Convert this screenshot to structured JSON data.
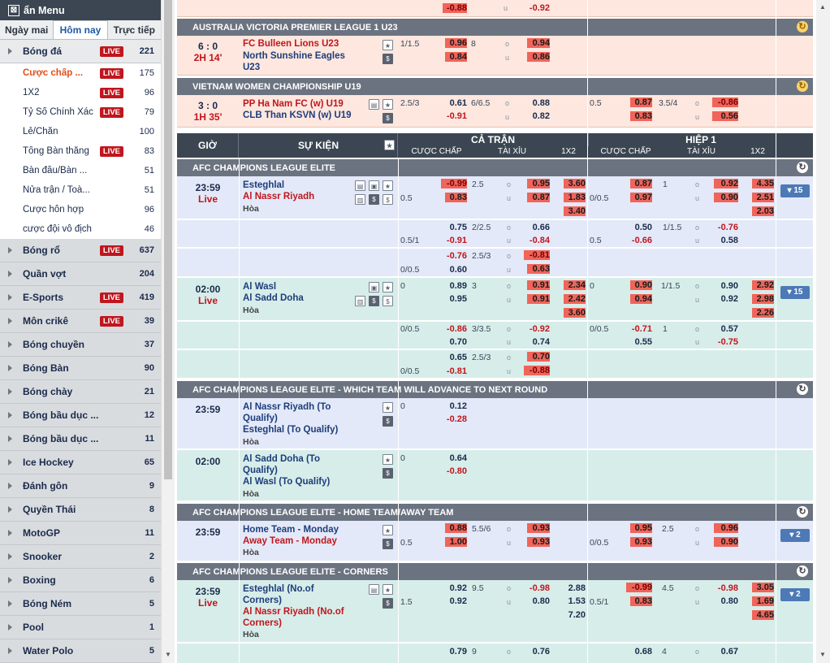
{
  "sidebar": {
    "menu_title": "ẩn Menu",
    "tabs": [
      "Ngày mai",
      "Hôm nay",
      "Trực tiếp"
    ],
    "active_tab": 1,
    "live_label": "LIVE",
    "first_sport": {
      "name": "Bóng đá",
      "count": "221",
      "live": true
    },
    "subs": [
      {
        "name": "Cược chấp ...",
        "count": "175",
        "live": true,
        "active": true
      },
      {
        "name": "1X2",
        "count": "96",
        "live": true
      },
      {
        "name": "Tỷ Số Chính Xác",
        "count": "79",
        "live": true
      },
      {
        "name": "Lẻ/Chẵn",
        "count": "100",
        "live": false
      },
      {
        "name": "Tổng Bàn thắng",
        "count": "83",
        "live": true
      },
      {
        "name": "Bàn đầu/Bàn ...",
        "count": "51",
        "live": false
      },
      {
        "name": "Nửa trận / Toà...",
        "count": "51",
        "live": false
      },
      {
        "name": "Cược hỗn hợp",
        "count": "96",
        "live": false
      },
      {
        "name": "cược đội vô địch",
        "count": "46",
        "live": false
      }
    ],
    "sports": [
      {
        "name": "Bóng rổ",
        "count": "637",
        "live": true
      },
      {
        "name": "Quần vợt",
        "count": "204",
        "live": false
      },
      {
        "name": "E-Sports",
        "count": "419",
        "live": true
      },
      {
        "name": "Môn crikê",
        "count": "39",
        "live": true
      },
      {
        "name": "Bóng chuyền",
        "count": "37",
        "live": false
      },
      {
        "name": "Bóng Bàn",
        "count": "90",
        "live": false
      },
      {
        "name": "Bóng chày",
        "count": "21",
        "live": false
      },
      {
        "name": "Bóng bầu dục ...",
        "count": "12",
        "live": false
      },
      {
        "name": "Bóng bầu dục ...",
        "count": "11",
        "live": false
      },
      {
        "name": "Ice Hockey",
        "count": "65",
        "live": false
      },
      {
        "name": "Đánh gôn",
        "count": "9",
        "live": false
      },
      {
        "name": "Quyền Thái",
        "count": "8",
        "live": false
      },
      {
        "name": "MotoGP",
        "count": "11",
        "live": false
      },
      {
        "name": "Snooker",
        "count": "2",
        "live": false
      },
      {
        "name": "Boxing",
        "count": "6",
        "live": false
      },
      {
        "name": "Bóng Ném",
        "count": "5",
        "live": false
      },
      {
        "name": "Pool",
        "count": "1",
        "live": false
      },
      {
        "name": "Water Polo",
        "count": "5",
        "live": false
      }
    ]
  },
  "top_partial": {
    "v1": "-0.88",
    "u": "u",
    "v2": "-0.92"
  },
  "live_leagues": [
    {
      "name": "AUSTRALIA VICTORIA PREMIER LEAGUE 1 U23",
      "score": "6 : 0",
      "status": "2H 14'",
      "home": "FC Bulleen Lions U23",
      "away": "North Sunshine Eagles U23",
      "hdp": "1/1.5",
      "hdp_home": "0.96",
      "hdp_away": "0.84",
      "ou_line": "8",
      "o": "o",
      "u": "u",
      "ou_over": "0.94",
      "ou_under": "0.86"
    },
    {
      "name": "VIETNAM WOMEN CHAMPIONSHIP U19",
      "score": "3 : 0",
      "status": "1H 35'",
      "home": "PP Ha Nam FC (w) U19",
      "away": "CLB Than KSVN (w) U19",
      "hdp": "2.5/3",
      "hdp_home": "0.61",
      "hdp_away": "-0.91",
      "ou_line": "6/6.5",
      "o": "o",
      "u": "u",
      "ou_over": "0.88",
      "ou_under": "0.82",
      "h1_hdp": "0.5",
      "h1_home": "0.87",
      "h1_away": "0.83",
      "h1_ou_line": "3.5/4",
      "h1_over": "-0.86",
      "h1_under": "0.56"
    }
  ],
  "table_header": {
    "time": "GIỜ",
    "event": "SỰ KIỆN",
    "full": "CẢ TRẬN",
    "half": "HIỆP 1",
    "hdp": "CƯỢC CHẤP",
    "ou": "TÀI XỈU",
    "x12": "1X2"
  },
  "sections": [
    {
      "title": "AFC CHAMPIONS LEAGUE ELITE"
    },
    {
      "title": "AFC CHAMPIONS LEAGUE ELITE - WHICH TEAM WILL ADVANCE TO NEXT ROUND"
    },
    {
      "title": "AFC CHAMPIONS LEAGUE ELITE - HOME TEAM/AWAY TEAM"
    },
    {
      "title": "AFC CHAMPIONS LEAGUE ELITE - CORNERS"
    }
  ],
  "draw_label": "Hòa",
  "m1": {
    "time": "23:59",
    "status": "Live",
    "home": "Esteghlal",
    "away": "Al Nassr Riyadh",
    "more": "▾ 15",
    "r1": [
      "-0.99",
      "2.5",
      "0.95",
      "3.60",
      "0.87",
      "1",
      "0.92",
      "4.35"
    ],
    "r2": [
      "0.5",
      "0.83",
      "0.87",
      "1.83",
      "0/0.5",
      "0.97",
      "0.90",
      "2.51"
    ],
    "r3": [
      "3.40",
      "2.03"
    ],
    "l2a": [
      "0.75",
      "2/2.5",
      "0.66",
      "0.50",
      "1/1.5",
      "-0.76"
    ],
    "l2b": [
      "0.5/1",
      "-0.91",
      "-0.84",
      "0.5",
      "-0.66",
      "0.58"
    ],
    "l3a": [
      "-0.76",
      "2.5/3",
      "-0.81"
    ],
    "l3b": [
      "0/0.5",
      "0.60",
      "0.63"
    ]
  },
  "m2": {
    "time": "02:00",
    "status": "Live",
    "home": "Al Wasl",
    "away": "Al Sadd Doha",
    "more": "▾ 15",
    "r1": [
      "0",
      "0.89",
      "3",
      "0.91",
      "2.34",
      "0",
      "0.90",
      "1/1.5",
      "0.90",
      "2.92"
    ],
    "r2": [
      "0.95",
      "0.91",
      "2.42",
      "0.94",
      "0.92",
      "2.98"
    ],
    "r3": [
      "3.60",
      "2.26"
    ],
    "l2a": [
      "0/0.5",
      "-0.86",
      "3/3.5",
      "-0.92",
      "0/0.5",
      "-0.71",
      "1",
      "0.57"
    ],
    "l2b": [
      "0.70",
      "0.74",
      "0.55",
      "-0.75"
    ],
    "l3a": [
      "0.65",
      "2.5/3",
      "0.70"
    ],
    "l3b": [
      "0/0.5",
      "-0.81",
      "-0.88"
    ]
  },
  "adv1": {
    "time": "23:59",
    "home": "Al Nassr Riyadh (To Qualify)",
    "away": "Esteghlal (To Qualify)",
    "hdp": "0",
    "v1": "0.12",
    "v2": "-0.28"
  },
  "adv2": {
    "time": "02:00",
    "home": "Al Sadd Doha (To Qualify)",
    "away": "Al Wasl (To Qualify)",
    "hdp": "0",
    "v1": "0.64",
    "v2": "-0.80"
  },
  "ha": {
    "time": "23:59",
    "home": "Home Team - Monday",
    "away": "Away Team - Monday",
    "more": "▾ 2",
    "r1": [
      "0.88",
      "5.5/6",
      "0.93",
      "0.95",
      "2.5",
      "0.96"
    ],
    "r2": [
      "0.5",
      "1.00",
      "0.93",
      "0/0.5",
      "0.93",
      "0.90"
    ]
  },
  "cn": {
    "time": "23:59",
    "status": "Live",
    "home": "Esteghlal (No.of Corners)",
    "away": "Al Nassr Riyadh (No.of Corners)",
    "more": "▾ 2",
    "r1": [
      "0.92",
      "9.5",
      "-0.98",
      "2.88",
      "-0.99",
      "4.5",
      "-0.98",
      "3.05"
    ],
    "r2": [
      "1.5",
      "0.92",
      "0.80",
      "1.53",
      "0.5/1",
      "0.83",
      "0.80",
      "1.69"
    ],
    "r3": [
      "7.20",
      "4.65"
    ],
    "last": [
      "0.79",
      "9",
      "0.76",
      "0.68",
      "4",
      "0.67"
    ]
  }
}
